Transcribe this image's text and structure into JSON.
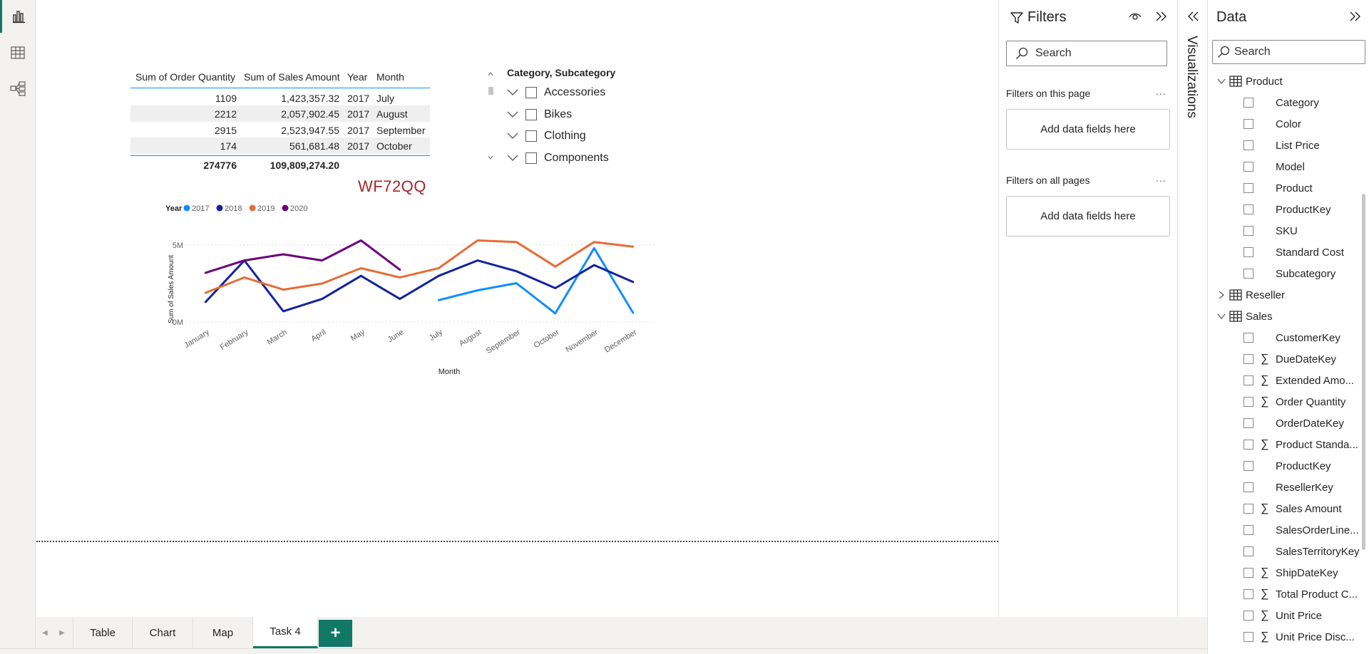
{
  "left_rail": {
    "items": [
      {
        "icon": "report-view-icon",
        "active": true
      },
      {
        "icon": "table-view-icon",
        "active": false
      },
      {
        "icon": "model-view-icon",
        "active": false
      }
    ]
  },
  "table_visual": {
    "headers": [
      "Sum of Order Quantity",
      "Sum of Sales Amount",
      "Year",
      "Month"
    ],
    "rows": [
      {
        "qty": "1109",
        "amount": "1,423,357.32",
        "year": "2017",
        "month": "July"
      },
      {
        "qty": "2212",
        "amount": "2,057,902.45",
        "year": "2017",
        "month": "August"
      },
      {
        "qty": "2915",
        "amount": "2,523,947.55",
        "year": "2017",
        "month": "September"
      },
      {
        "qty": "174",
        "amount": "561,681.48",
        "year": "2017",
        "month": "October"
      }
    ],
    "total": {
      "qty": "274776",
      "amount": "109,809,274.20"
    }
  },
  "slicer": {
    "title": "Category, Subcategory",
    "items": [
      "Accessories",
      "Bikes",
      "Clothing",
      "Components"
    ]
  },
  "watermark_label": "WF72QQ",
  "chart_data": {
    "type": "line",
    "title": "",
    "legend_title": "Year",
    "legend_position": "top-left",
    "xlabel": "Month",
    "ylabel": "Sum of Sales Amount",
    "categories": [
      "January",
      "February",
      "March",
      "April",
      "May",
      "June",
      "July",
      "August",
      "September",
      "October",
      "November",
      "December"
    ],
    "y_ticks": [
      "0M",
      "5M"
    ],
    "ylim": [
      0,
      5000000
    ],
    "gridlines": true,
    "series": [
      {
        "name": "2017",
        "color": "#118dff",
        "values": [
          null,
          null,
          null,
          null,
          null,
          null,
          1423357,
          2057902,
          2523948,
          561681,
          4800000,
          600000
        ]
      },
      {
        "name": "2018",
        "color": "#12239e",
        "values": [
          1300000,
          4000000,
          700000,
          1500000,
          3000000,
          1500000,
          3000000,
          4000000,
          3300000,
          2200000,
          3700000,
          2600000
        ]
      },
      {
        "name": "2019",
        "color": "#e66c37",
        "values": [
          1900000,
          2900000,
          2100000,
          2500000,
          3500000,
          2900000,
          3500000,
          5300000,
          5200000,
          3600000,
          5200000,
          4900000
        ]
      },
      {
        "name": "2020",
        "color": "#6b007b",
        "values": [
          3200000,
          4000000,
          4400000,
          4000000,
          5300000,
          3400000,
          null,
          null,
          null,
          null,
          null,
          null
        ]
      }
    ]
  },
  "tabs": [
    {
      "label": "Table",
      "active": false
    },
    {
      "label": "Chart",
      "active": false
    },
    {
      "label": "Map",
      "active": false
    },
    {
      "label": "Task 4",
      "active": true
    }
  ],
  "add_page_label": "+",
  "filters_pane": {
    "title": "Filters",
    "search_placeholder": "Search",
    "page_section": "Filters on this page",
    "all_pages_section": "Filters on all pages",
    "drop_well": "Add data fields here",
    "more": "..."
  },
  "visualizations_label": "Visualizations",
  "data_pane": {
    "title": "Data",
    "search_placeholder": "Search",
    "tables": [
      {
        "name": "Product",
        "expanded": true,
        "fields": [
          {
            "name": "Category",
            "sum": false
          },
          {
            "name": "Color",
            "sum": false
          },
          {
            "name": "List Price",
            "sum": false
          },
          {
            "name": "Model",
            "sum": false
          },
          {
            "name": "Product",
            "sum": false
          },
          {
            "name": "ProductKey",
            "sum": false
          },
          {
            "name": "SKU",
            "sum": false
          },
          {
            "name": "Standard Cost",
            "sum": false
          },
          {
            "name": "Subcategory",
            "sum": false
          }
        ]
      },
      {
        "name": "Reseller",
        "expanded": false,
        "fields": []
      },
      {
        "name": "Sales",
        "expanded": true,
        "fields": [
          {
            "name": "CustomerKey",
            "sum": false
          },
          {
            "name": "DueDateKey",
            "sum": true
          },
          {
            "name": "Extended Amo...",
            "sum": true
          },
          {
            "name": "Order Quantity",
            "sum": true
          },
          {
            "name": "OrderDateKey",
            "sum": false
          },
          {
            "name": "Product Standa...",
            "sum": true
          },
          {
            "name": "ProductKey",
            "sum": false
          },
          {
            "name": "ResellerKey",
            "sum": false
          },
          {
            "name": "Sales Amount",
            "sum": true
          },
          {
            "name": "SalesOrderLine...",
            "sum": false
          },
          {
            "name": "SalesTerritoryKey",
            "sum": false
          },
          {
            "name": "ShipDateKey",
            "sum": true
          },
          {
            "name": "Total Product C...",
            "sum": true
          },
          {
            "name": "Unit Price",
            "sum": true
          },
          {
            "name": "Unit Price Disc...",
            "sum": true
          }
        ]
      }
    ]
  }
}
